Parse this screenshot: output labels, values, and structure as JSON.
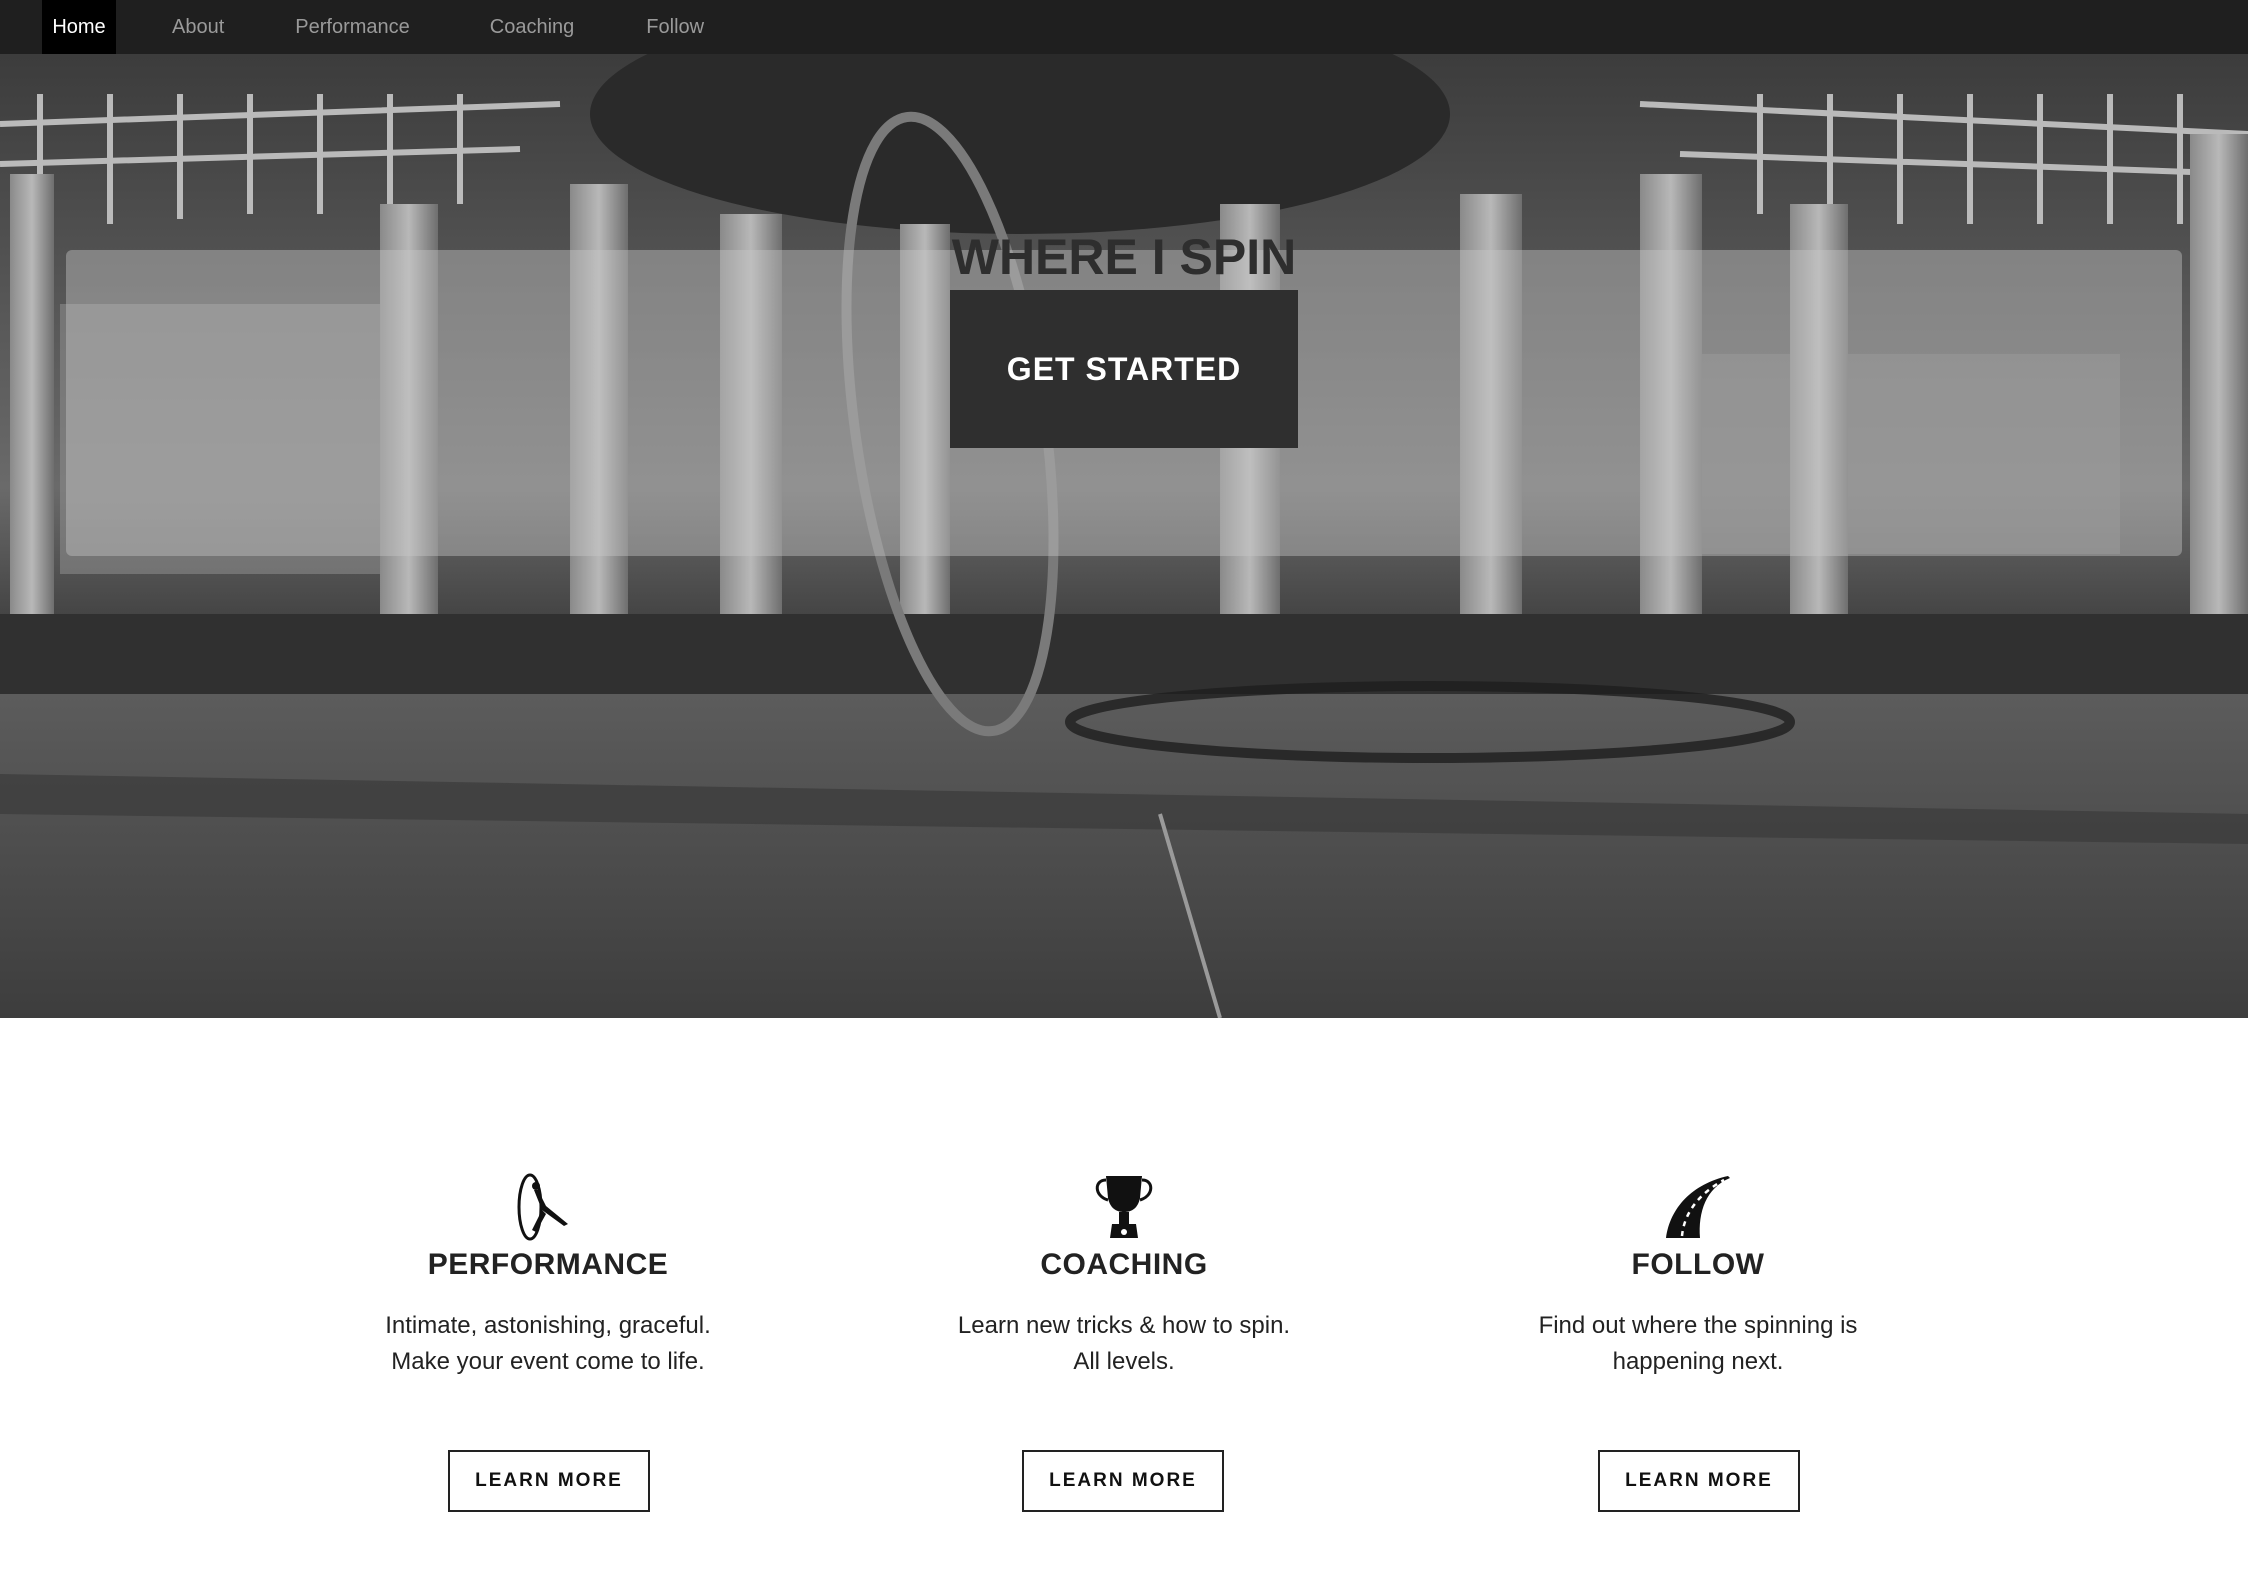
{
  "nav": {
    "items": [
      {
        "label": "Home",
        "active": true
      },
      {
        "label": "About",
        "active": false
      },
      {
        "label": "Performance",
        "active": false
      },
      {
        "label": "Coaching",
        "active": false
      },
      {
        "label": "Follow",
        "active": false
      }
    ]
  },
  "hero": {
    "title": "WHERE I SPIN",
    "cta_label": "GET STARTED"
  },
  "features": [
    {
      "icon": "wheel-gymnast-icon",
      "title": "PERFORMANCE",
      "line1": "Intimate, astonishing, graceful.",
      "line2": "Make your event come to life.",
      "button": "LEARN MORE"
    },
    {
      "icon": "trophy-icon",
      "title": "COACHING",
      "line1": "Learn new tricks & how to spin.",
      "line2": "All levels.",
      "button": "LEARN MORE"
    },
    {
      "icon": "road-icon",
      "title": "FOLLOW",
      "line1": "Find out where the spinning is",
      "line2": "happening next.",
      "button": "LEARN MORE"
    }
  ],
  "colors": {
    "nav_bg": "#1f1f1f",
    "nav_active_bg": "#000000",
    "cta_bg": "#2f2f2f"
  }
}
